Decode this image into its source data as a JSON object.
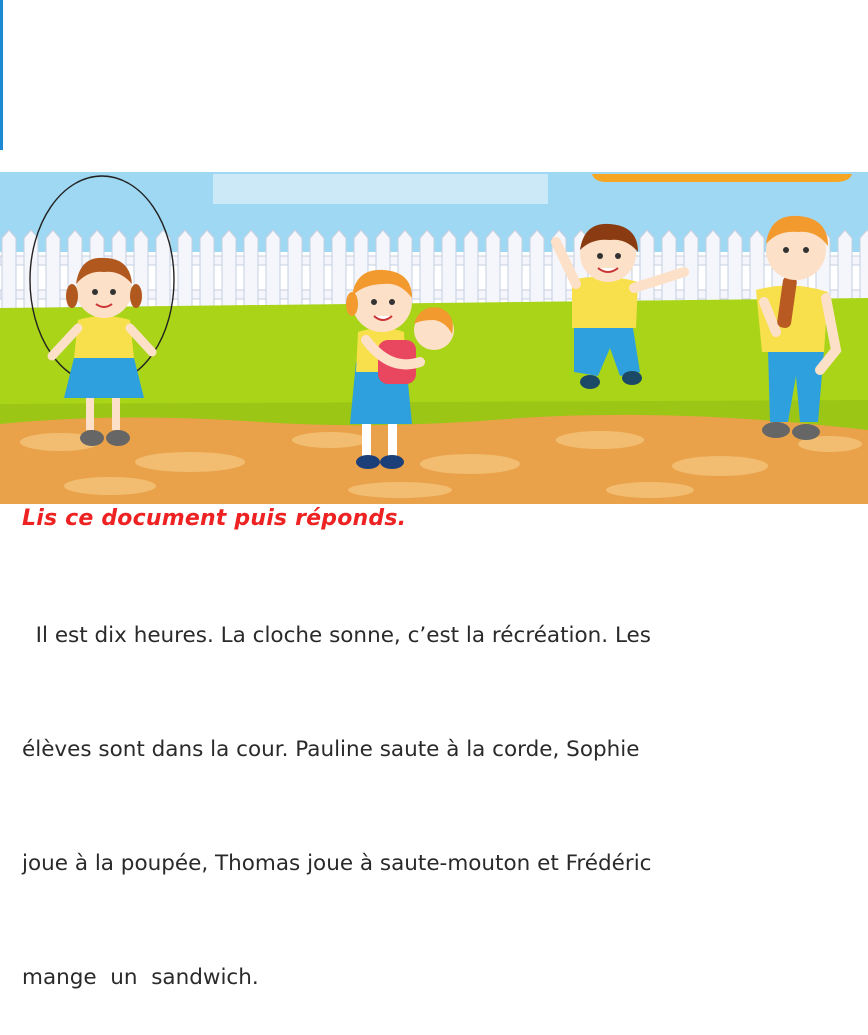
{
  "heading": "Lis ce document puis réponds.",
  "paragraph_lines": [
    "  Il est dix heures. La cloche sonne, c’est la récréation. Les",
    "élèves sont dans la cour. Pauline saute à la corde, Sophie",
    "joue à la poupée, Thomas joue à saute-mouton et Frédéric",
    "mange  un  sandwich."
  ],
  "colors": {
    "heading": "#ee2222",
    "text": "#2a2a2a",
    "sky": "#9fd8f2",
    "fence": "#f4f6fb",
    "grass": "#a9d417",
    "ground": "#e9a24a"
  },
  "illustration": {
    "characters": [
      "girl-jumping-rope",
      "girl-holding-doll",
      "boy-jumping",
      "boy-eating-sandwich"
    ]
  }
}
